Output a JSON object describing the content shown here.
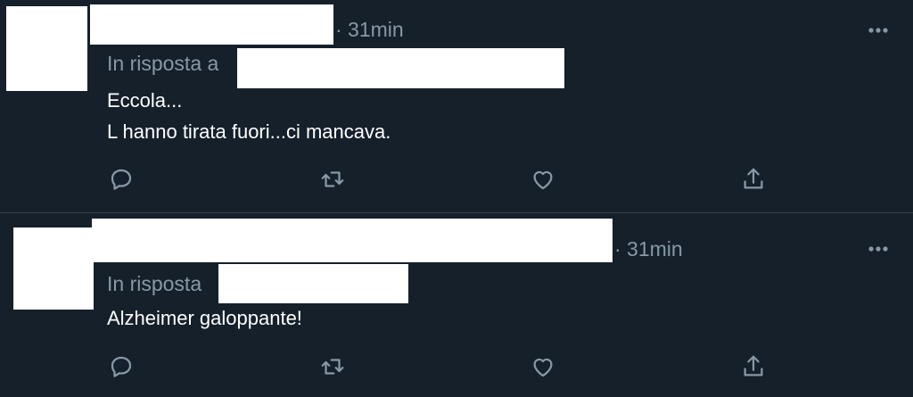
{
  "tweets": [
    {
      "time": "· 31min",
      "reply_label": "In risposta a",
      "body_lines": [
        "Eccola...",
        "L hanno tirata fuori...ci mancava."
      ]
    },
    {
      "time": "· 31min",
      "reply_label": "In risposta",
      "body_lines": [
        "Alzheimer galoppante!"
      ]
    }
  ],
  "icons": {
    "reply": "reply-icon",
    "retweet": "retweet-icon",
    "like": "heart-icon",
    "share": "share-icon",
    "more": "more-icon"
  },
  "colors": {
    "background": "#15202b",
    "text": "#ffffff",
    "muted": "#8899a6",
    "divider": "#38444d"
  }
}
